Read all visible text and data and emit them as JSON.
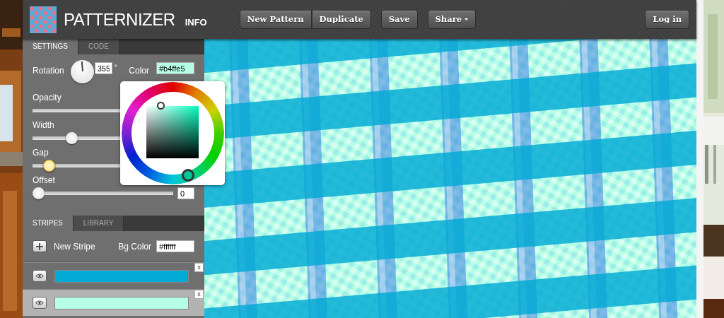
{
  "header": {
    "logo": "PATTERNIZER",
    "info_link": "INFO",
    "button_group": [
      "New Pattern",
      "Duplicate"
    ],
    "save_button": "Save",
    "share_button": "Share",
    "login_button": "Log in"
  },
  "settings_tabs": [
    {
      "label": "SETTINGS",
      "selected": true
    },
    {
      "label": "CODE",
      "selected": false
    }
  ],
  "settings": {
    "rotation_label": "Rotation",
    "rotation": "355",
    "rotation_unit": "°",
    "color_label": "Color",
    "color": "#b4ffe5",
    "sliders": [
      {
        "label": "Opacity"
      },
      {
        "label": "Width",
        "level": 0.22,
        "focused": false
      },
      {
        "label": "Gap",
        "level": 0.07,
        "focused": true
      },
      {
        "label": "Offset",
        "level": 0,
        "value": "0",
        "focused": false
      }
    ]
  },
  "color_picker": {
    "open": true
  },
  "stripe_tabs": [
    {
      "label": "STRIPES",
      "selected": true
    },
    {
      "label": "LIBRARY",
      "selected": false
    }
  ],
  "stripes_toolbar": {
    "new_stripe": "New Stripe",
    "bg_color_label": "Bg Color",
    "bg_color": "#ffffff"
  },
  "stripes": [
    {
      "color": "#00aad4",
      "selected": false,
      "remove": "x"
    },
    {
      "color": "#b4ffe5",
      "selected": true,
      "remove": "x"
    }
  ]
}
